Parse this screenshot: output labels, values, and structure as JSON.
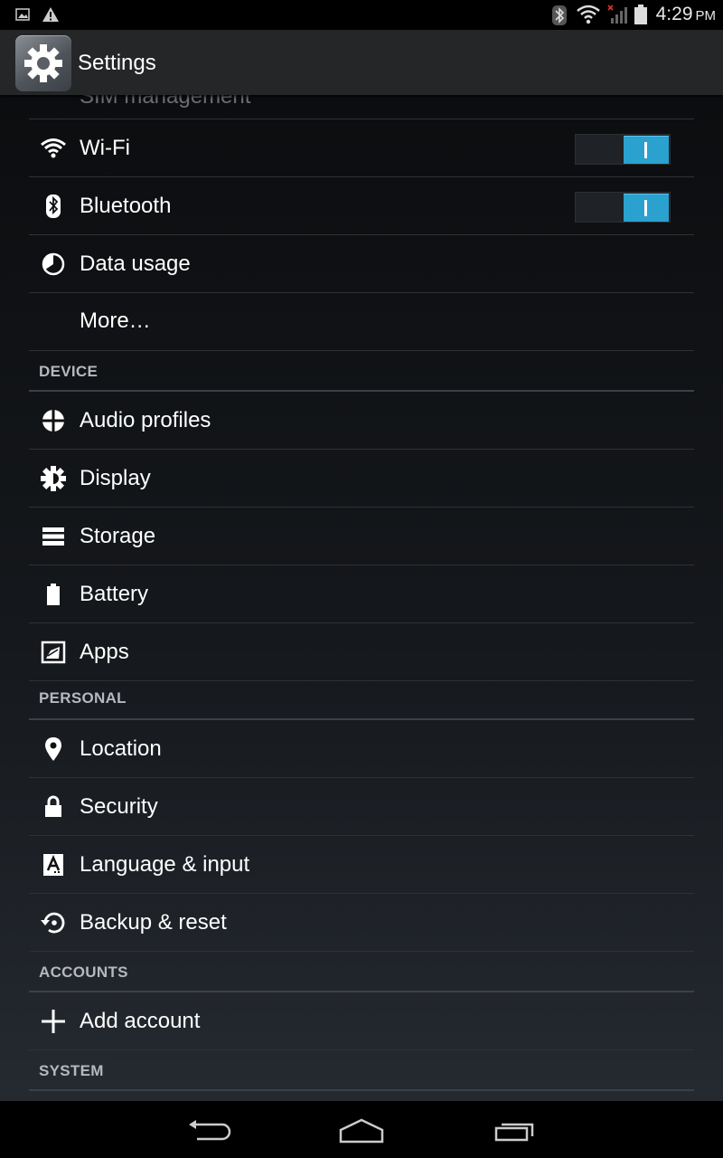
{
  "status_bar": {
    "time": "4:29",
    "ampm": "PM",
    "left_icons": [
      "gallery-notification-icon",
      "warning-notification-icon"
    ],
    "right_icons": [
      "bluetooth-icon",
      "wifi-icon",
      "no-signal-icon",
      "battery-icon"
    ]
  },
  "action_bar": {
    "title": "Settings",
    "icon": "settings-gear-icon"
  },
  "list": {
    "ghost_item": "SIM management",
    "wireless": [
      {
        "label": "Wi-Fi",
        "icon": "wifi-icon",
        "toggle": "on"
      },
      {
        "label": "Bluetooth",
        "icon": "bluetooth-icon",
        "toggle": "on"
      },
      {
        "label": "Data usage",
        "icon": "data-usage-icon"
      },
      {
        "label": "More…"
      }
    ],
    "device_header": "DEVICE",
    "device": [
      {
        "label": "Audio profiles",
        "icon": "audio-profiles-icon"
      },
      {
        "label": "Display",
        "icon": "display-icon"
      },
      {
        "label": "Storage",
        "icon": "storage-icon"
      },
      {
        "label": "Battery",
        "icon": "battery-icon"
      },
      {
        "label": "Apps",
        "icon": "apps-icon"
      }
    ],
    "personal_header": "PERSONAL",
    "personal": [
      {
        "label": "Location",
        "icon": "location-icon"
      },
      {
        "label": "Security",
        "icon": "lock-icon"
      },
      {
        "label": "Language & input",
        "icon": "language-icon"
      },
      {
        "label": "Backup & reset",
        "icon": "backup-icon"
      }
    ],
    "accounts_header": "ACCOUNTS",
    "accounts": [
      {
        "label": "Add account",
        "icon": "plus-icon"
      }
    ],
    "system_header": "SYSTEM"
  },
  "nav_bar": {
    "buttons": [
      "back-icon",
      "home-icon",
      "recent-apps-icon"
    ]
  },
  "colors": {
    "accent": "#2aa1cf",
    "statusbar_bg": "#000000",
    "actionbar_bg": "#242628",
    "divider": "#2e3237",
    "section_text": "#b5b9bf"
  }
}
